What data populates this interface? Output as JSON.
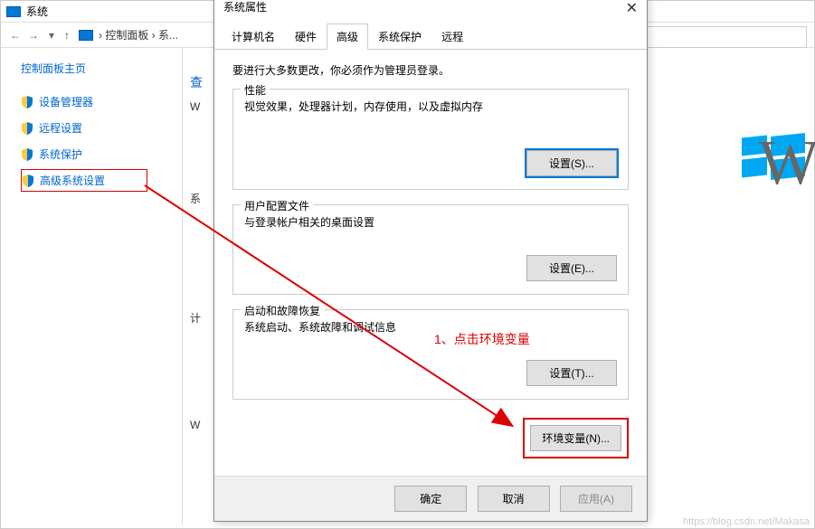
{
  "explorer": {
    "title": "系统",
    "breadcrumb_1": "控制面板",
    "breadcrumb_2": "系..."
  },
  "sidebar": {
    "title": "控制面板主页",
    "items": [
      {
        "label": "设备管理器"
      },
      {
        "label": "远程设置"
      },
      {
        "label": "系统保护"
      },
      {
        "label": "高级系统设置"
      }
    ]
  },
  "main": {
    "char1": "查",
    "charW": "W",
    "char2": "系",
    "char3": "计",
    "char4": "W",
    "bigW": "W"
  },
  "dialog": {
    "title": "系统属性",
    "tabs": [
      {
        "label": "计算机名"
      },
      {
        "label": "硬件"
      },
      {
        "label": "高级"
      },
      {
        "label": "系统保护"
      },
      {
        "label": "远程"
      }
    ],
    "intro": "要进行大多数更改，你必须作为管理员登录。",
    "perf": {
      "legend": "性能",
      "desc": "视觉效果，处理器计划，内存使用，以及虚拟内存",
      "btn": "设置(S)..."
    },
    "profile": {
      "legend": "用户配置文件",
      "desc": "与登录帐户相关的桌面设置",
      "btn": "设置(E)..."
    },
    "startup": {
      "legend": "启动和故障恢复",
      "desc": "系统启动、系统故障和调试信息",
      "btn": "设置(T)..."
    },
    "env_btn": "环境变量(N)...",
    "footer": {
      "ok": "确定",
      "cancel": "取消",
      "apply": "应用(A)"
    }
  },
  "annotation": "1、点击环境变量",
  "watermark": "https://blog.csdn.net/Makasa"
}
